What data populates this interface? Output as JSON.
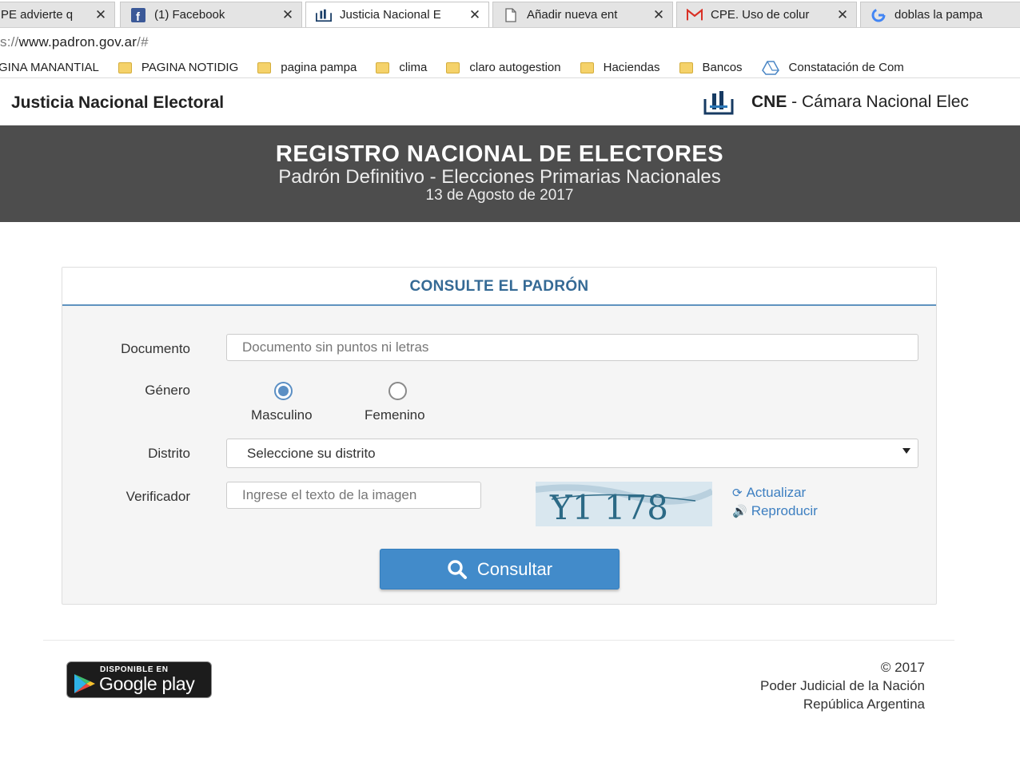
{
  "browser": {
    "tabs": [
      {
        "title": "PE advierte q",
        "icon": "page-icon",
        "active": false
      },
      {
        "title": "(1) Facebook",
        "icon": "facebook-icon",
        "active": false
      },
      {
        "title": "Justicia Nacional E",
        "icon": "cne-icon",
        "active": true
      },
      {
        "title": "Añadir nueva ent",
        "icon": "document-icon",
        "active": false
      },
      {
        "title": "CPE. Uso de colur",
        "icon": "gmail-icon",
        "active": false
      },
      {
        "title": "doblas la pampa",
        "icon": "google-icon",
        "active": false
      }
    ],
    "tab_close": "✕",
    "url_prefix": "s://",
    "url_host": "www.padron.gov.ar",
    "url_path": "/#",
    "bookmarks": [
      {
        "label": "GINA MANANTIAL",
        "icon": "none"
      },
      {
        "label": "PAGINA NOTIDIG",
        "icon": "folder-icon"
      },
      {
        "label": "pagina pampa",
        "icon": "folder-icon"
      },
      {
        "label": "clima",
        "icon": "folder-icon"
      },
      {
        "label": "claro autogestion",
        "icon": "folder-icon"
      },
      {
        "label": "Haciendas",
        "icon": "folder-icon"
      },
      {
        "label": "Bancos",
        "icon": "folder-icon"
      },
      {
        "label": "Constatación de Com",
        "icon": "drive-icon"
      }
    ]
  },
  "site": {
    "brand": "Justicia Nacional Electoral",
    "cne_abbr": "CNE",
    "cne_name": " - Cámara Nacional Elec"
  },
  "banner": {
    "title": "REGISTRO NACIONAL DE ELECTORES",
    "subtitle": "Padrón Definitivo - Elecciones Primarias Nacionales",
    "date": "13 de Agosto de 2017"
  },
  "form": {
    "title": "CONSULTE EL PADRÓN",
    "documento_label": "Documento",
    "documento_placeholder": "Documento sin puntos ni letras",
    "documento_value": "",
    "genero_label": "Género",
    "genero_options": [
      {
        "label": "Masculino",
        "checked": true
      },
      {
        "label": "Femenino",
        "checked": false
      }
    ],
    "distrito_label": "Distrito",
    "distrito_selected": "Seleccione su distrito",
    "verificador_label": "Verificador",
    "verificador_placeholder": "Ingrese el texto de la imagen",
    "verificador_value": "",
    "captcha_text": "Y1 178",
    "actualizar": "Actualizar",
    "reproducir": "Reproducir",
    "submit": "Consultar"
  },
  "footer": {
    "gplay_small": "DISPONIBLE EN",
    "gplay_big": "Google play",
    "copyright": "© 2017",
    "org": "Poder Judicial de la Nación",
    "country": "República Argentina"
  },
  "colors": {
    "banner_bg": "#4d4d4d",
    "accent": "#428bca",
    "title_blue": "#356a95",
    "link_blue": "#3d7fc1"
  }
}
